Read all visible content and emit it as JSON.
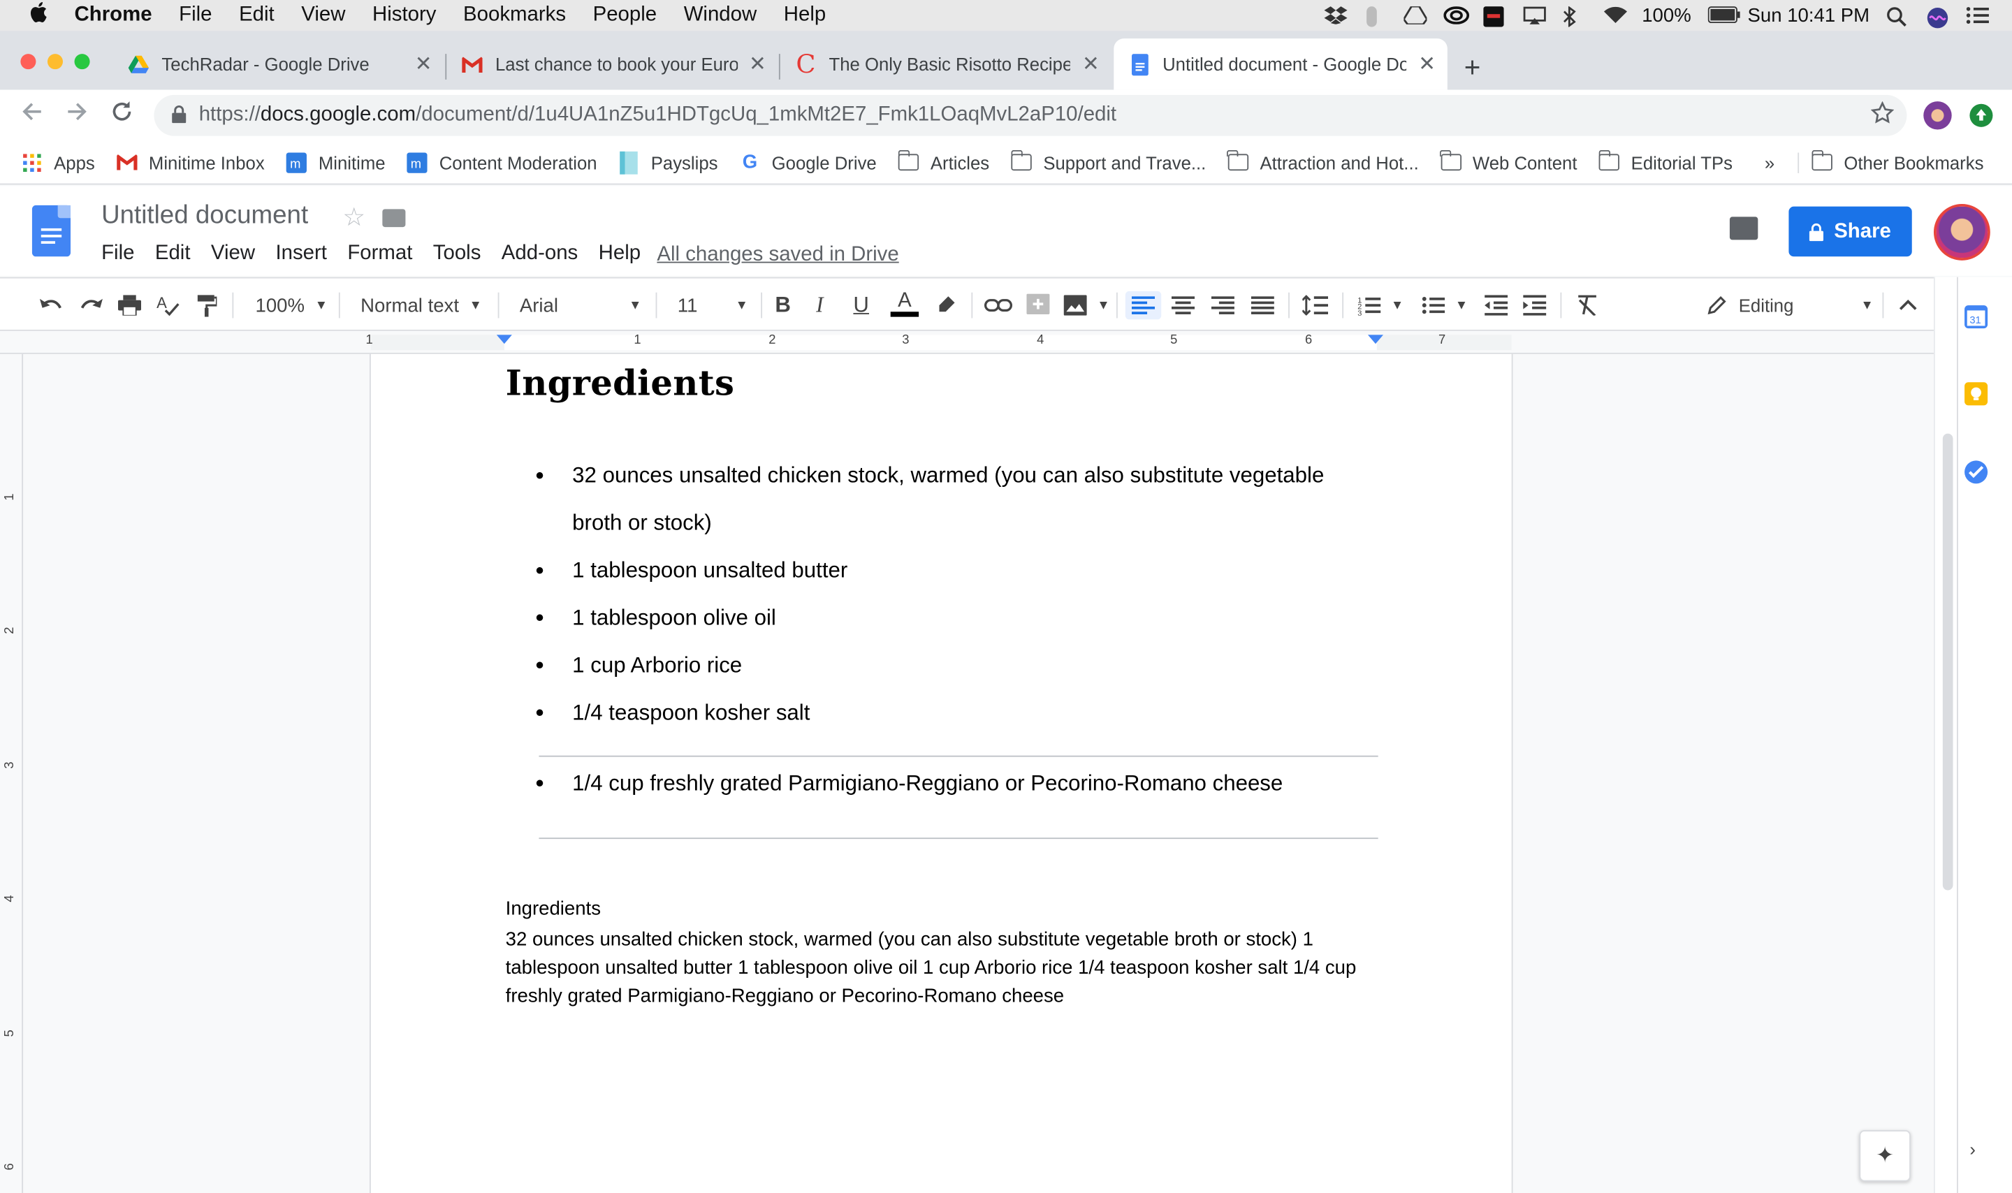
{
  "menubar": {
    "apple": "",
    "app": "Chrome",
    "items": [
      "File",
      "Edit",
      "View",
      "History",
      "Bookmarks",
      "People",
      "Window",
      "Help"
    ],
    "battery": "100%",
    "clock": "Sun 10:41 PM"
  },
  "tabs": [
    {
      "title": "TechRadar - Google Drive",
      "icon": "google-drive-icon"
    },
    {
      "title": "Last chance to book your Europ",
      "icon": "gmail-icon"
    },
    {
      "title": "The Only Basic Risotto Recipe",
      "icon": "c-logo-icon"
    },
    {
      "title": "Untitled document - Google Do",
      "icon": "google-docs-icon"
    }
  ],
  "omnibox": {
    "scheme": "https://",
    "host": "docs.google.com",
    "path": "/document/d/1u4UA1nZ5u1HDTgcUq_1mkMt2E7_Fmk1LOaqMvL2aP10/edit"
  },
  "bookmarks": [
    {
      "label": "Apps",
      "icon": "apps-grid-icon"
    },
    {
      "label": "Minitime Inbox",
      "icon": "gmail-icon"
    },
    {
      "label": "Minitime",
      "icon": "minitime-icon"
    },
    {
      "label": "Content Moderation",
      "icon": "minitime-icon"
    },
    {
      "label": "Payslips",
      "icon": "payslips-icon"
    },
    {
      "label": "Google Drive",
      "icon": "google-icon"
    },
    {
      "label": "Articles",
      "icon": "folder-icon"
    },
    {
      "label": "Support and Trave...",
      "icon": "folder-icon"
    },
    {
      "label": "Attraction and Hot...",
      "icon": "folder-icon"
    },
    {
      "label": "Web Content",
      "icon": "folder-icon"
    },
    {
      "label": "Editorial TPs",
      "icon": "folder-icon"
    }
  ],
  "bookmarks_more": "»",
  "bookmarks_other": "Other Bookmarks",
  "doc": {
    "title": "Untitled document",
    "menu": [
      "File",
      "Edit",
      "View",
      "Insert",
      "Format",
      "Tools",
      "Add-ons",
      "Help"
    ],
    "saved_status": "All changes saved in Drive",
    "share_label": "Share"
  },
  "toolbar": {
    "zoom": "100%",
    "style": "Normal text",
    "font": "Arial",
    "size": "11",
    "mode": "Editing"
  },
  "ruler": {
    "numbers": [
      "1",
      "1",
      "2",
      "3",
      "4",
      "5",
      "6",
      "7"
    ],
    "vnumbers": [
      "1",
      "2",
      "3",
      "4",
      "5",
      "6"
    ]
  },
  "content": {
    "heading": "Ingredients",
    "bullets": [
      "32 ounces unsalted chicken stock, warmed (you can also substitute vegetable broth or stock)",
      "1 tablespoon unsalted butter",
      "1 tablespoon olive oil",
      "1 cup Arborio rice",
      "1/4 teaspoon kosher salt"
    ],
    "bullet_after_rule": "1/4 cup freshly grated Parmigiano-Reggiano or Pecorino-Romano cheese",
    "plain_heading": "Ingredients",
    "plain_paragraph": "32 ounces unsalted chicken stock, warmed (you can also substitute vegetable broth or stock) 1 tablespoon unsalted butter 1 tablespoon olive oil 1 cup Arborio rice 1/4 teaspoon kosher salt 1/4 cup freshly grated Parmigiano-Reggiano or Pecorino-Romano cheese"
  },
  "colors": {
    "accent": "#1a73e8",
    "docs_blue": "#4285f4"
  }
}
